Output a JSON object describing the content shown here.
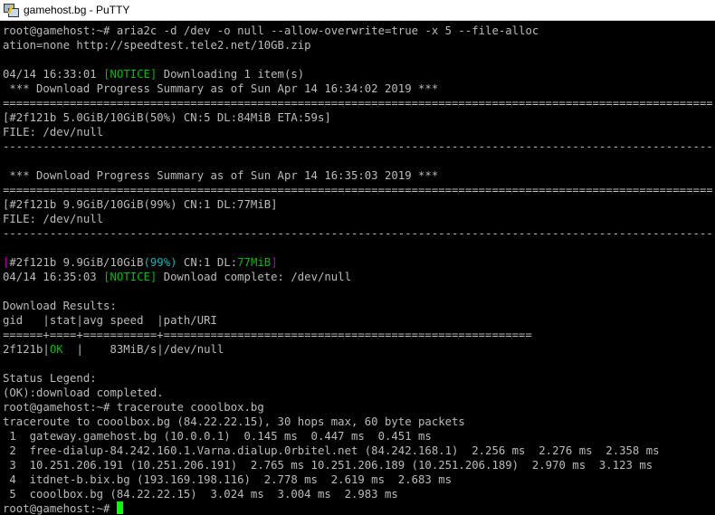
{
  "window": {
    "title": "gamehost.bg - PuTTY",
    "icon": "putty-icon"
  },
  "terminal": {
    "lines": [
      "root@gamehost:~# aria2c -d /dev -o null --allow-overwrite=true -x 5 --file-alloc",
      "ation=none http://speedtest.tele2.net/10GB.zip",
      "",
      "04/14 16:33:01 [NOTICE] Downloading 1 item(s)",
      " *** Download Progress Summary as of Sun Apr 14 16:34:02 2019 ***",
      "===============================================================================================================",
      "[#2f121b 5.0GiB/10GiB(50%) CN:5 DL:84MiB ETA:59s]",
      "FILE: /dev/null",
      "---------------------------------------------------------------------------------------------------------------",
      "",
      " *** Download Progress Summary as of Sun Apr 14 16:35:03 2019 ***",
      "===============================================================================================================",
      "[#2f121b 9.9GiB/10GiB(99%) CN:1 DL:77MiB]",
      "FILE: /dev/null",
      "---------------------------------------------------------------------------------------------------------------",
      "",
      "[#2f121b 9.9GiB/10GiB(99%) CN:1 DL:77MiB]",
      "04/14 16:35:03 [NOTICE] Download complete: /dev/null",
      "",
      "Download Results:",
      "gid   |stat|avg speed  |path/URI",
      "======+====+===========+=======================================================",
      "2f121b|OK  |    83MiB/s|/dev/null",
      "",
      "Status Legend:",
      "(OK):download completed.",
      "root@gamehost:~# traceroute cooolbox.bg",
      "traceroute to cooolbox.bg (84.22.22.15), 30 hops max, 60 byte packets",
      " 1  gateway.gamehost.bg (10.0.0.1)  0.145 ms  0.447 ms  0.451 ms",
      " 2  free-dialup-84.242.160.1.Varna.dialup.0rbitel.net (84.242.168.1)  2.256 ms  2.276 ms  2.358 ms",
      " 3  10.251.206.191 (10.251.206.191)  2.765 ms 10.251.206.189 (10.251.206.189)  2.970 ms  3.123 ms",
      " 4  itdnet-b.bix.bg (193.169.198.116)  2.778 ms  2.619 ms  2.683 ms",
      " 5  cooolbox.bg (84.22.22.15)  3.024 ms  3.004 ms  2.983 ms",
      "root@gamehost:~# "
    ],
    "colors": {
      "default": "#bbbbbb",
      "green": "#00c000",
      "cyan": "#00bbbb",
      "magenta": "#bb00bb",
      "cursor": "#00ff00"
    }
  }
}
